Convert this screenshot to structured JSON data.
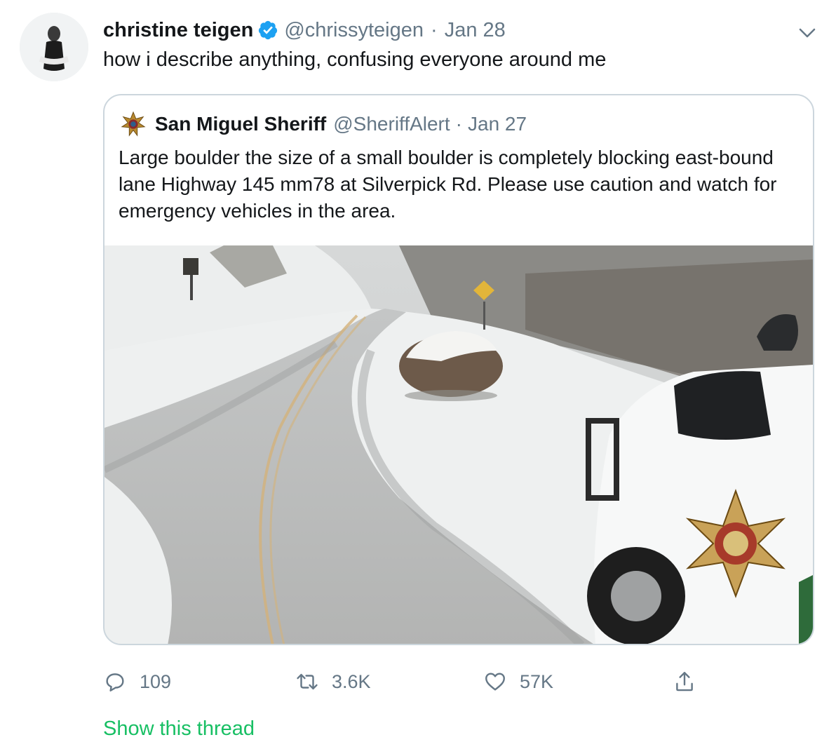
{
  "tweet": {
    "display_name": "christine teigen",
    "handle": "@chrissyteigen",
    "separator": "·",
    "date": "Jan 28",
    "text": "how i describe anything, confusing everyone around me",
    "verified_icon": "verified-badge-icon",
    "more_icon": "chevron-down-icon"
  },
  "quoted": {
    "display_name": "San Miguel Sheriff",
    "handle": "@SheriffAlert",
    "separator": "·",
    "date": "Jan 27",
    "text": "Large boulder the size of a small boulder is completely blocking east-bound lane Highway 145 mm78 at Silverpick Rd. Please use caution and watch for emergency vehicles in the area.",
    "avatar_icon": "sheriff-star-icon"
  },
  "actions": {
    "reply": {
      "icon": "reply-icon",
      "count": "109"
    },
    "retweet": {
      "icon": "retweet-icon",
      "count": "3.6K"
    },
    "like": {
      "icon": "heart-icon",
      "count": "57K"
    },
    "share": {
      "icon": "share-icon"
    }
  },
  "show_thread": "Show this thread",
  "colors": {
    "text": "#14171a",
    "secondary": "#657786",
    "border": "#ccd6dd",
    "verified": "#1da1f2",
    "thread_link": "#17bf63"
  }
}
